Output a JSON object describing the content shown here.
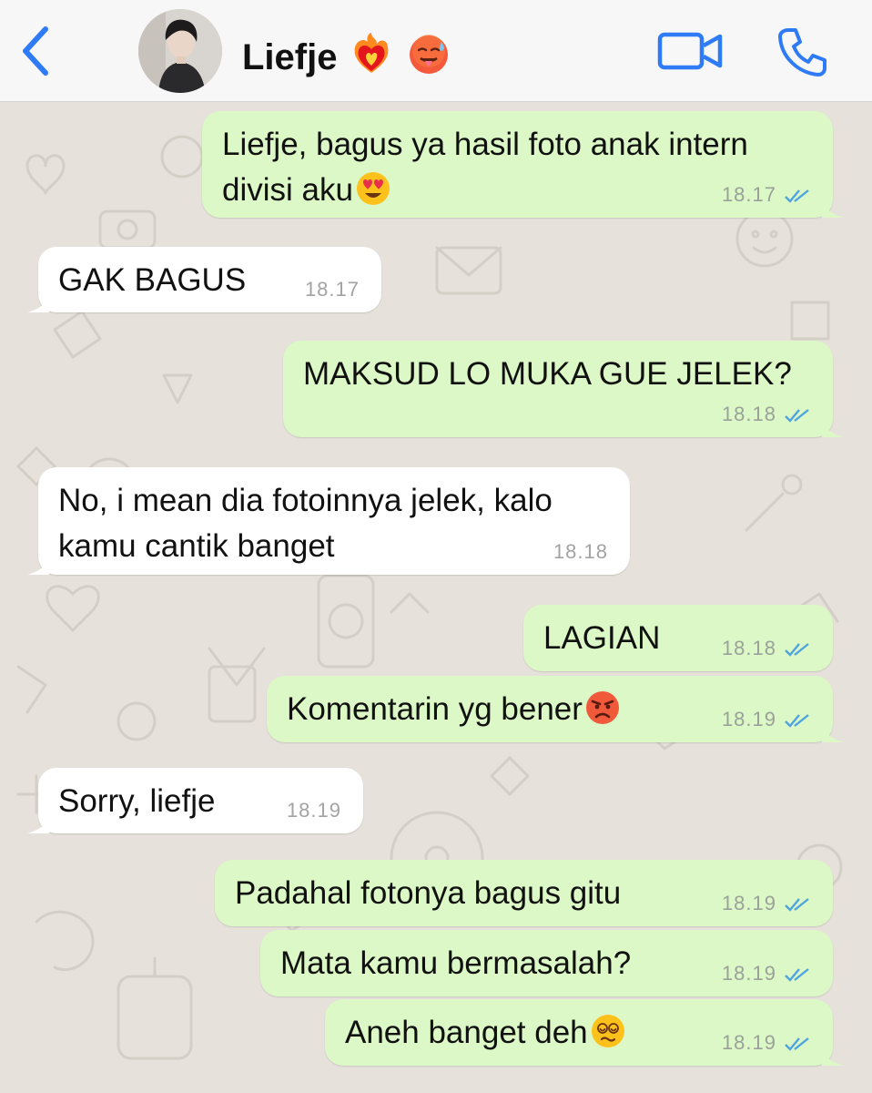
{
  "header": {
    "contact_name": "Liefje",
    "name_emojis": [
      "heart-on-fire-emoji",
      "hot-face-emoji"
    ],
    "back_icon": "chevron-left-icon",
    "video_icon": "video-camera-icon",
    "call_icon": "phone-icon",
    "accent_color": "#2f7bf5"
  },
  "messages": [
    {
      "dir": "out",
      "text": "Liefje, bagus ya hasil foto anak intern divisi aku",
      "emoji": "heart-eyes-emoji",
      "time": "18.17",
      "status": "read"
    },
    {
      "dir": "in",
      "text": "GAK BAGUS",
      "time": "18.17"
    },
    {
      "dir": "out",
      "text": "MAKSUD LO MUKA GUE JELEK?",
      "time": "18.18",
      "status": "read"
    },
    {
      "dir": "in",
      "text": "No, i mean dia fotoinnya jelek, kalo kamu cantik banget",
      "time": "18.18"
    },
    {
      "dir": "out",
      "text": "LAGIAN",
      "time": "18.18",
      "status": "read"
    },
    {
      "dir": "out",
      "text": "Komentarin yg bener",
      "emoji": "angry-face-emoji",
      "time": "18.19",
      "status": "read"
    },
    {
      "dir": "in",
      "text": "Sorry, liefje",
      "time": "18.19"
    },
    {
      "dir": "out",
      "text": "Padahal fotonya bagus gitu",
      "time": "18.19",
      "status": "read"
    },
    {
      "dir": "out",
      "text": "Mata kamu bermasalah?",
      "time": "18.19",
      "status": "read"
    },
    {
      "dir": "out",
      "text": "Aneh banget deh",
      "emoji": "dizzy-face-emoji",
      "time": "18.19",
      "status": "read"
    }
  ],
  "colors": {
    "outgoing_bubble": "#dcf8c6",
    "incoming_bubble": "#ffffff",
    "read_ticks": "#4fa3e0",
    "wallpaper": "#e6e2db"
  }
}
